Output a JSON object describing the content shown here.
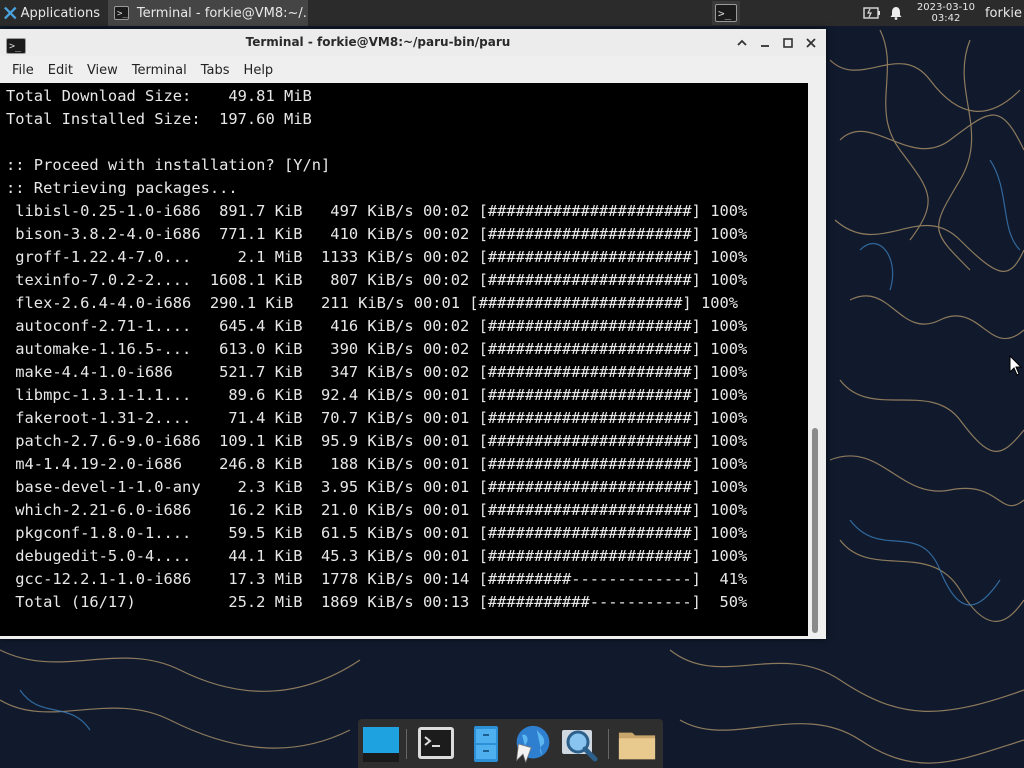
{
  "taskbar": {
    "applications_label": "Applications",
    "task_title": "Terminal - forkie@VM8:~/...",
    "clock": {
      "date": "2023-03-10",
      "time": "03:42"
    },
    "user": "forkie"
  },
  "window": {
    "title": "Terminal - forkie@VM8:~/paru-bin/paru",
    "menu": [
      "File",
      "Edit",
      "View",
      "Terminal",
      "Tabs",
      "Help"
    ]
  },
  "terminal": {
    "lines": [
      "Total Download Size:    49.81 MiB",
      "Total Installed Size:  197.60 MiB",
      "",
      ":: Proceed with installation? [Y/n]",
      ":: Retrieving packages...",
      " libisl-0.25-1.0-i686  891.7 KiB   497 KiB/s 00:02 [######################] 100%",
      " bison-3.8.2-4.0-i686  771.1 KiB   410 KiB/s 00:02 [######################] 100%",
      " groff-1.22.4-7.0...     2.1 MiB  1133 KiB/s 00:02 [######################] 100%",
      " texinfo-7.0.2-2....  1608.1 KiB   807 KiB/s 00:02 [######################] 100%",
      " flex-2.6.4-4.0-i686  290.1 KiB   211 KiB/s 00:01 [######################] 100%",
      " autoconf-2.71-1....   645.4 KiB   416 KiB/s 00:02 [######################] 100%",
      " automake-1.16.5-...   613.0 KiB   390 KiB/s 00:02 [######################] 100%",
      " make-4.4-1.0-i686     521.7 KiB   347 KiB/s 00:02 [######################] 100%",
      " libmpc-1.3.1-1.1...    89.6 KiB  92.4 KiB/s 00:01 [######################] 100%",
      " fakeroot-1.31-2....    71.4 KiB  70.7 KiB/s 00:01 [######################] 100%",
      " patch-2.7.6-9.0-i686  109.1 KiB  95.9 KiB/s 00:01 [######################] 100%",
      " m4-1.4.19-2.0-i686    246.8 KiB   188 KiB/s 00:01 [######################] 100%",
      " base-devel-1-1.0-any    2.3 KiB  3.95 KiB/s 00:01 [######################] 100%",
      " which-2.21-6.0-i686    16.2 KiB  21.0 KiB/s 00:01 [######################] 100%",
      " pkgconf-1.8.0-1....    59.5 KiB  61.5 KiB/s 00:01 [######################] 100%",
      " debugedit-5.0-4....    44.1 KiB  45.3 KiB/s 00:01 [######################] 100%",
      " gcc-12.2.1-1.0-i686    17.3 MiB  1778 KiB/s 00:14 [#########-------------]  41%",
      " Total (16/17)          25.2 MiB  1869 KiB/s 00:13 [###########-----------]  50%"
    ]
  },
  "dock": {
    "items": [
      "show-desktop",
      "terminal",
      "file-cabinet",
      "web-browser",
      "search",
      "files"
    ]
  }
}
